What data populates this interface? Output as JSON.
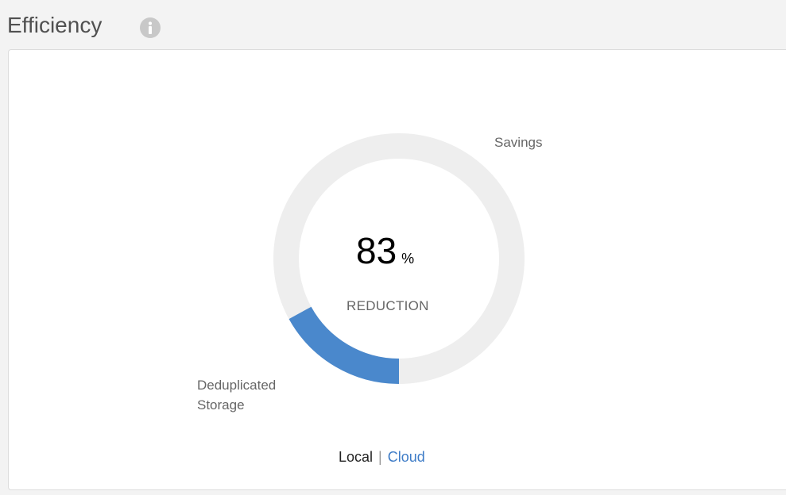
{
  "panel": {
    "title": "Efficiency",
    "info_icon": "info-icon"
  },
  "donut": {
    "reduction_percent": 83,
    "value_text": "83",
    "unit": "%",
    "caption": "REDUCTION",
    "savings_label": "Savings",
    "dedup_label_line1": "Deduplicated",
    "dedup_label_line2": "Storage",
    "colors": {
      "savings": "#eeeeee",
      "deduplicated": "#4a88cc"
    }
  },
  "toggle": {
    "local_label": "Local",
    "separator": "|",
    "cloud_label": "Cloud",
    "selected": "Local"
  }
}
